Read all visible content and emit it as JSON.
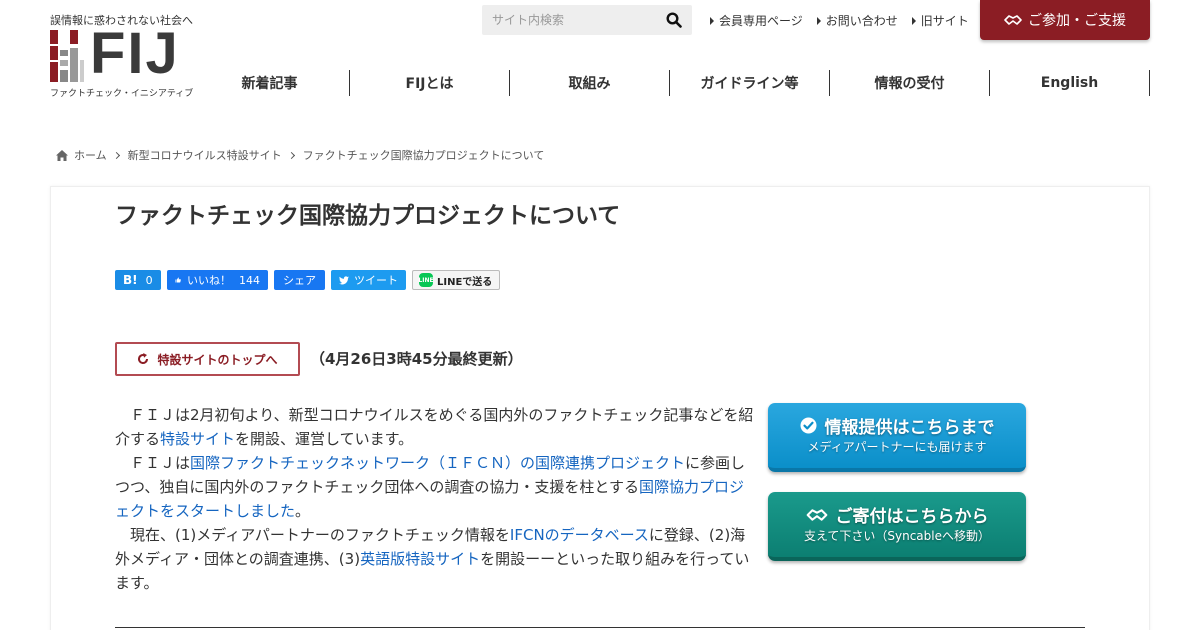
{
  "header": {
    "tagline": "誤情報に惑わされない社会へ",
    "logo_text": "FIJ",
    "logo_sub": "ファクトチェック・イニシアティブ",
    "search_placeholder": "サイト内検索",
    "top_links": [
      "会員専用ページ",
      "お問い合わせ",
      "旧サイト"
    ],
    "join_label": "ご参加・ご支援",
    "brand_color": "#8b1d24"
  },
  "nav": {
    "items": [
      "新着記事",
      "FIJとは",
      "取組み",
      "ガイドライン等",
      "情報の受付",
      "English"
    ]
  },
  "breadcrumb": {
    "home": "ホーム",
    "level1": "新型コロナウイルス特設サイト",
    "current": "ファクトチェック国際協力プロジェクトについて"
  },
  "article": {
    "title": "ファクトチェック国際協力プロジェクトについて",
    "share": {
      "hatena_label": "B!",
      "hatena_count": "0",
      "like_label": "いいね！",
      "like_count": "144",
      "share_label": "シェア",
      "tweet_label": "ツイート",
      "line_label": "LINEで送る",
      "line_icon_text": "LINE"
    },
    "top_button": "特設サイトのトップへ",
    "updated": "（4月26日3時45分最終更新）",
    "p1_a": "ＦＩＪは2月初旬より、新型コロナウイルスをめぐる国内外のファクトチェック記事などを紹介する",
    "p1_link": "特設サイト",
    "p1_b": "を開設、運営しています。",
    "p2_a": "ＦＩＪは",
    "p2_link1": "国際ファクトチェックネットワーク（ＩＦＣＮ）の国際連携プロジェクト",
    "p2_b": "に参画しつつ、独自に国内外のファクトチェック団体への調査の協力・支援を柱とする",
    "p2_link2": "国際協力プロジェクトをスタートしました",
    "p2_c": "。",
    "p3_a": "現在、(1)メディアパートナーのファクトチェック情報を",
    "p3_link1": "IFCNのデータベース",
    "p3_b": "に登録、(2)海外メディア・団体との調査連携、(3)",
    "p3_link2": "英語版特設サイト",
    "p3_c": "を開設ーーといった取り組みを行っています。"
  },
  "cta": {
    "info_main": "情報提供はこちらまで",
    "info_sub": "メディアパートナーにも届けます",
    "info_color": "#1a9ad6",
    "donate_main": "ご寄付はこちらから",
    "donate_sub": "支えて下さい（Syncableへ移動）",
    "donate_color": "#128a7d"
  }
}
